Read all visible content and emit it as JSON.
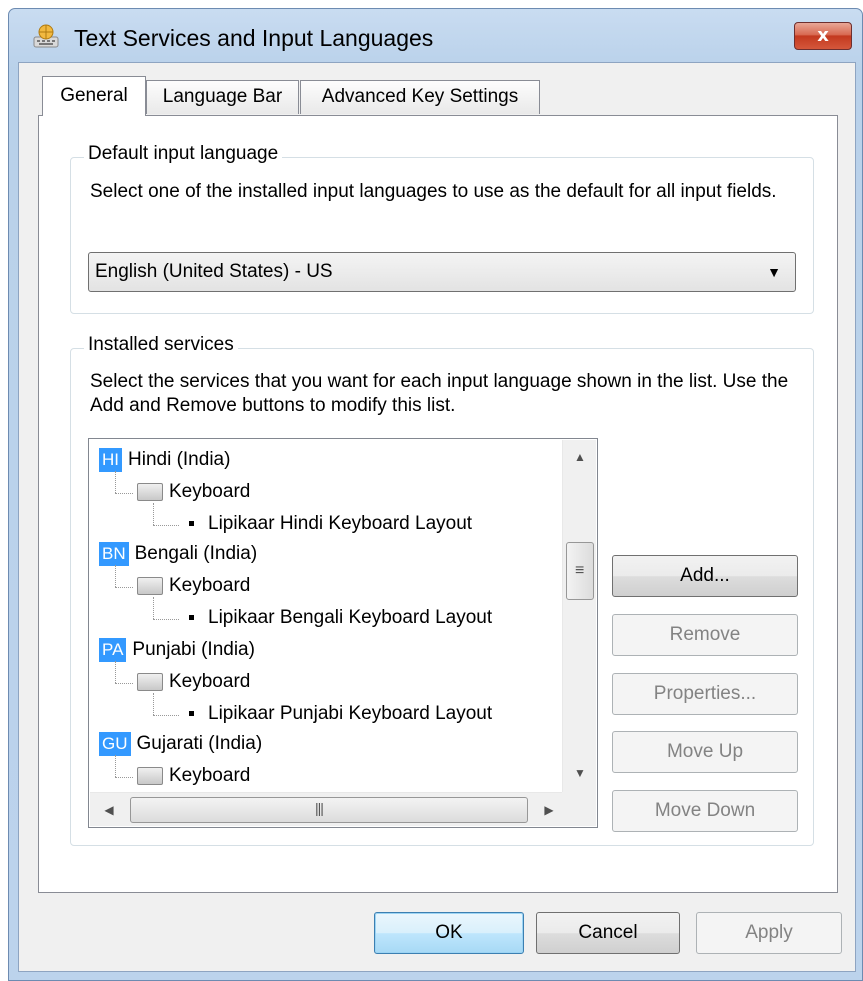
{
  "window": {
    "title": "Text Services and Input Languages",
    "close_label": "x"
  },
  "tabs": [
    {
      "label": "General",
      "selected": true
    },
    {
      "label": "Language Bar",
      "selected": false
    },
    {
      "label": "Advanced Key Settings",
      "selected": false
    }
  ],
  "default_language": {
    "group_label": "Default input language",
    "description": "Select one of the installed input languages to use as the default for all input fields.",
    "selected_value": "English (United States) - US"
  },
  "installed_services": {
    "group_label": "Installed services",
    "description": "Select the services that you want for each input language shown in the list. Use the Add and Remove buttons to modify this list.",
    "tree": [
      {
        "badge": "HI",
        "language": "Hindi (India)",
        "service": "Keyboard",
        "layout": "Lipikaar Hindi Keyboard Layout"
      },
      {
        "badge": "BN",
        "language": "Bengali (India)",
        "service": "Keyboard",
        "layout": "Lipikaar Bengali Keyboard Layout"
      },
      {
        "badge": "PA",
        "language": "Punjabi (India)",
        "service": "Keyboard",
        "layout": "Lipikaar Punjabi Keyboard Layout"
      },
      {
        "badge": "GU",
        "language": "Gujarati (India)",
        "service": "Keyboard",
        "layout": ""
      }
    ],
    "buttons": {
      "add": "Add...",
      "remove": "Remove",
      "properties": "Properties...",
      "move_up": "Move Up",
      "move_down": "Move Down"
    }
  },
  "footer": {
    "ok": "OK",
    "cancel": "Cancel",
    "apply": "Apply"
  },
  "colors": {
    "badge": "#3399ff",
    "close_button": "#c3391f",
    "title_bar": "#b9d1ea"
  },
  "icons": {
    "window": "keyboard-globe-icon",
    "service": "keyboard-icon",
    "dropdown": "chevron-down-icon"
  }
}
